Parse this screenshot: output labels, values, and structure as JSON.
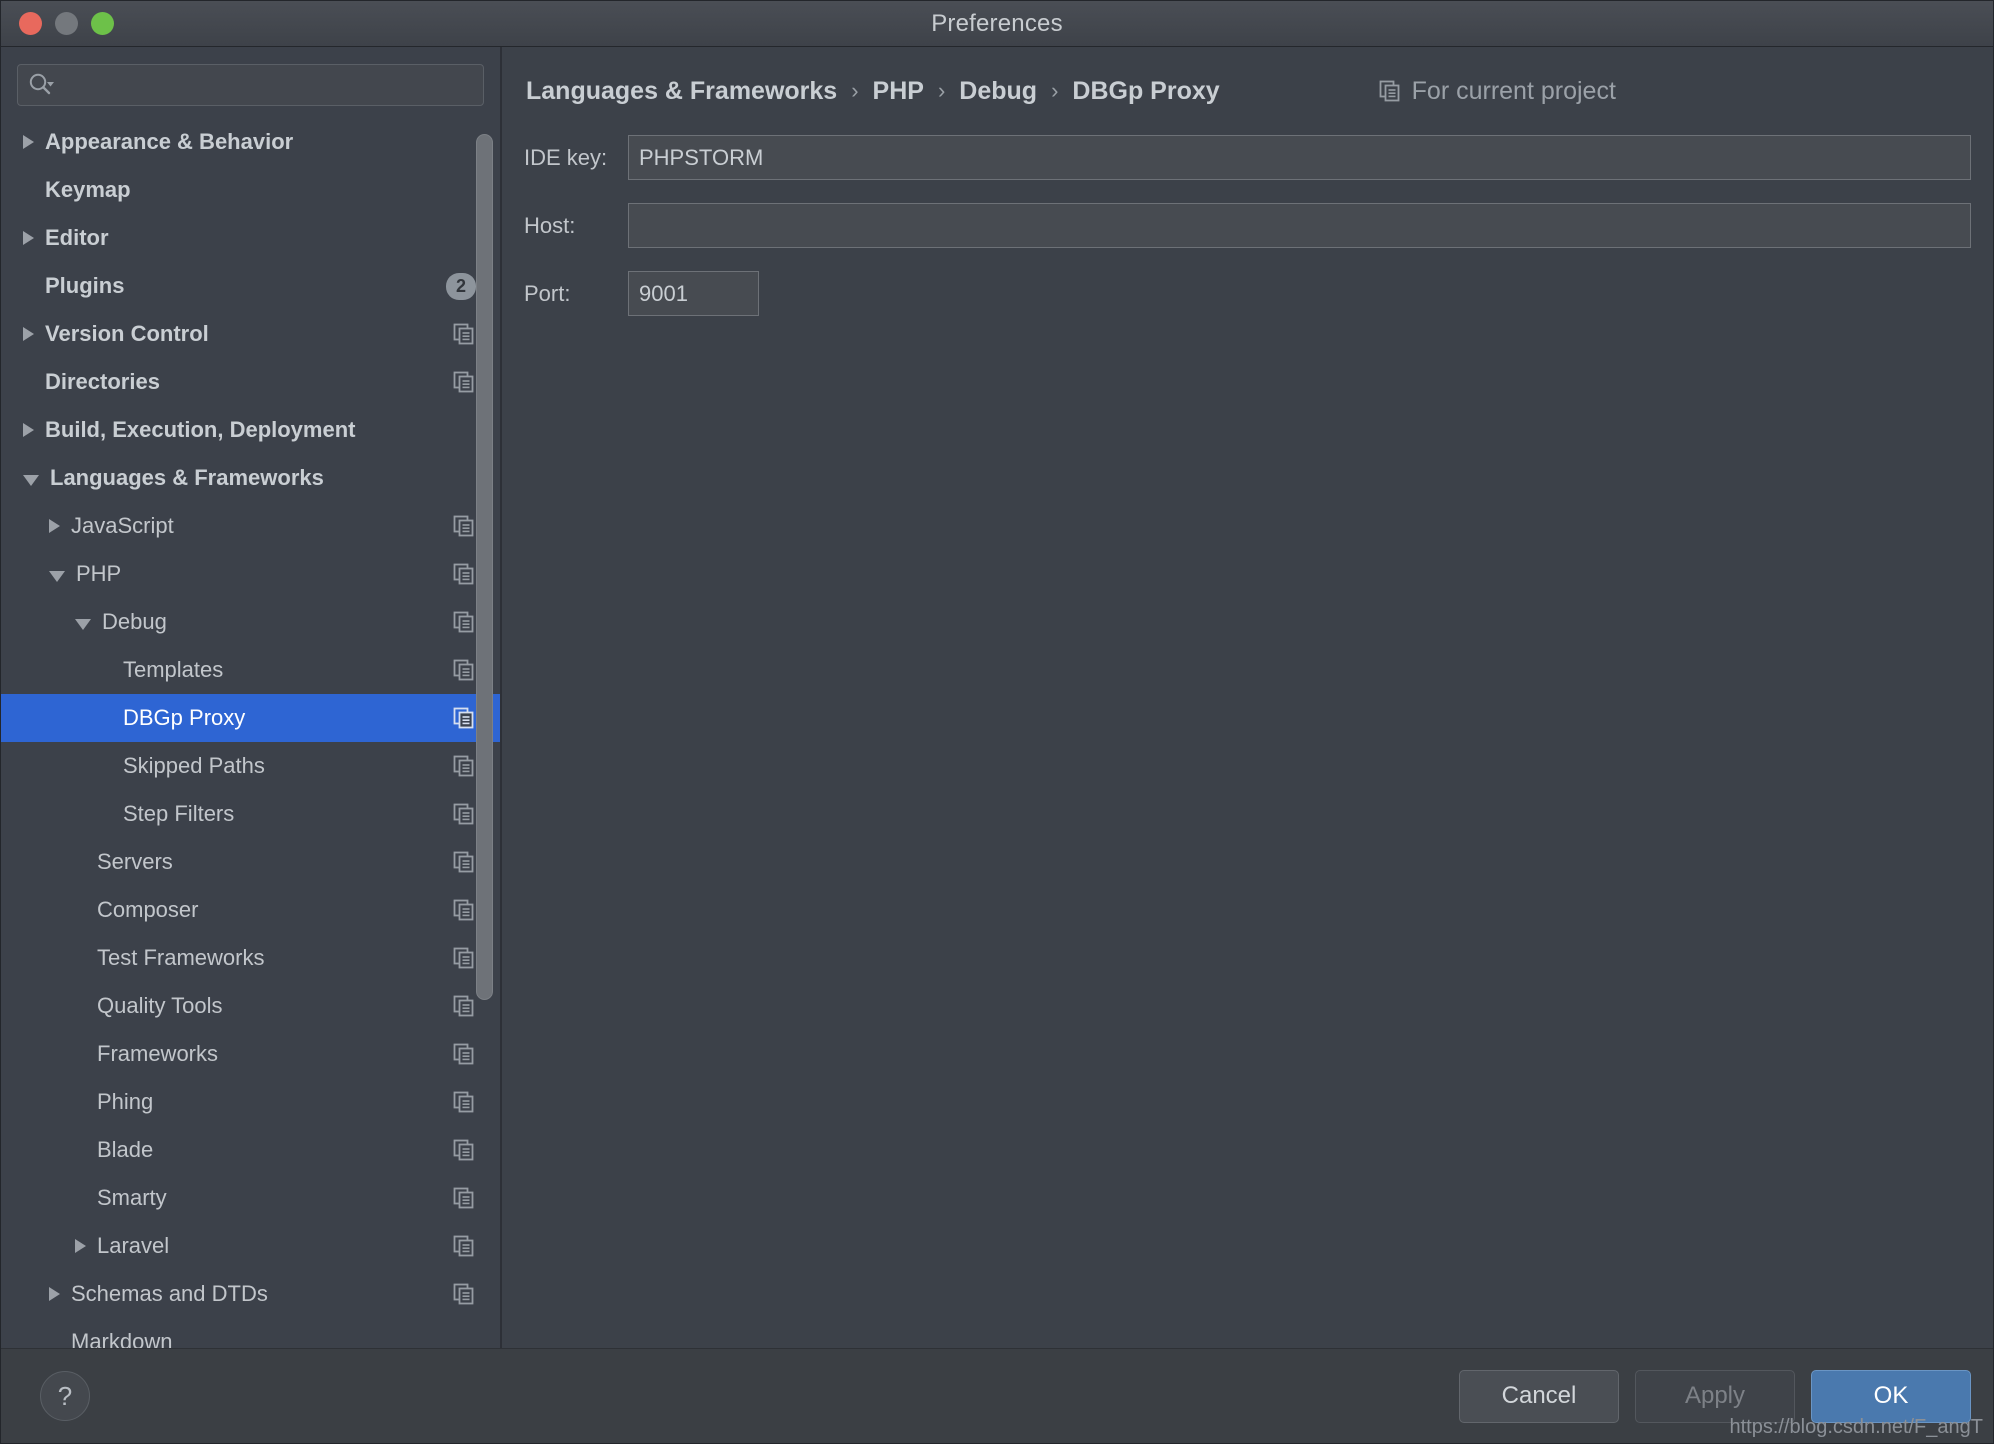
{
  "window": {
    "title": "Preferences",
    "traffic_lights": [
      "close-button",
      "minimize-button",
      "zoom-button"
    ]
  },
  "search": {
    "value": "",
    "placeholder": "",
    "icon": "search-icon"
  },
  "sidebar": {
    "items": [
      {
        "label": "Appearance & Behavior",
        "level": 0,
        "arrow": "collapsed",
        "badge": "",
        "copy": false,
        "selected": false
      },
      {
        "label": "Keymap",
        "level": 0,
        "arrow": "none",
        "badge": "",
        "copy": false,
        "selected": false
      },
      {
        "label": "Editor",
        "level": 0,
        "arrow": "collapsed",
        "badge": "",
        "copy": false,
        "selected": false
      },
      {
        "label": "Plugins",
        "level": 0,
        "arrow": "none",
        "badge": "2",
        "copy": false,
        "selected": false
      },
      {
        "label": "Version Control",
        "level": 0,
        "arrow": "collapsed",
        "badge": "",
        "copy": true,
        "selected": false
      },
      {
        "label": "Directories",
        "level": 0,
        "arrow": "none",
        "badge": "",
        "copy": true,
        "selected": false
      },
      {
        "label": "Build, Execution, Deployment",
        "level": 0,
        "arrow": "collapsed",
        "badge": "",
        "copy": false,
        "selected": false
      },
      {
        "label": "Languages & Frameworks",
        "level": 0,
        "arrow": "expanded",
        "badge": "",
        "copy": false,
        "selected": false
      },
      {
        "label": "JavaScript",
        "level": 1,
        "arrow": "collapsed",
        "badge": "",
        "copy": true,
        "selected": false
      },
      {
        "label": "PHP",
        "level": 1,
        "arrow": "expanded",
        "badge": "",
        "copy": true,
        "selected": false
      },
      {
        "label": "Debug",
        "level": 2,
        "arrow": "expanded",
        "badge": "",
        "copy": true,
        "selected": false
      },
      {
        "label": "Templates",
        "level": 3,
        "arrow": "none",
        "badge": "",
        "copy": true,
        "selected": false
      },
      {
        "label": "DBGp Proxy",
        "level": 3,
        "arrow": "none",
        "badge": "",
        "copy": true,
        "selected": true
      },
      {
        "label": "Skipped Paths",
        "level": 3,
        "arrow": "none",
        "badge": "",
        "copy": true,
        "selected": false
      },
      {
        "label": "Step Filters",
        "level": 3,
        "arrow": "none",
        "badge": "",
        "copy": true,
        "selected": false
      },
      {
        "label": "Servers",
        "level": 2,
        "arrow": "none",
        "badge": "",
        "copy": true,
        "selected": false
      },
      {
        "label": "Composer",
        "level": 2,
        "arrow": "none",
        "badge": "",
        "copy": true,
        "selected": false
      },
      {
        "label": "Test Frameworks",
        "level": 2,
        "arrow": "none",
        "badge": "",
        "copy": true,
        "selected": false
      },
      {
        "label": "Quality Tools",
        "level": 2,
        "arrow": "none",
        "badge": "",
        "copy": true,
        "selected": false
      },
      {
        "label": "Frameworks",
        "level": 2,
        "arrow": "none",
        "badge": "",
        "copy": true,
        "selected": false
      },
      {
        "label": "Phing",
        "level": 2,
        "arrow": "none",
        "badge": "",
        "copy": true,
        "selected": false
      },
      {
        "label": "Blade",
        "level": 2,
        "arrow": "none",
        "badge": "",
        "copy": true,
        "selected": false
      },
      {
        "label": "Smarty",
        "level": 2,
        "arrow": "none",
        "badge": "",
        "copy": true,
        "selected": false
      },
      {
        "label": "Laravel",
        "level": 2,
        "arrow": "collapsed",
        "badge": "",
        "copy": true,
        "selected": false
      },
      {
        "label": "Schemas and DTDs",
        "level": 1,
        "arrow": "collapsed",
        "badge": "",
        "copy": true,
        "selected": false
      },
      {
        "label": "Markdown",
        "level": 1,
        "arrow": "none",
        "badge": "",
        "copy": false,
        "selected": false
      }
    ]
  },
  "breadcrumb": {
    "crumbs": [
      "Languages & Frameworks",
      "PHP",
      "Debug",
      "DBGp Proxy"
    ],
    "separator": "›",
    "scope_label": "For current project",
    "scope_icon": "copy-icon"
  },
  "form": {
    "fields": [
      {
        "label": "IDE key:",
        "value": "PHPSTORM",
        "placeholder": "",
        "width": "wide",
        "name": "ide-key-field"
      },
      {
        "label": "Host:",
        "value": "",
        "placeholder": "",
        "width": "wide",
        "name": "host-field"
      },
      {
        "label": "Port:",
        "value": "9001",
        "placeholder": "",
        "width": "narrow",
        "name": "port-field"
      }
    ]
  },
  "footer": {
    "help_label": "?",
    "cancel_label": "Cancel",
    "apply_label": "Apply",
    "ok_label": "OK",
    "watermark": "https://blog.csdn.net/F_angT"
  },
  "colors": {
    "selection_blue": "#2e65d3",
    "primary_button": "#4a79ae",
    "window_bg": "#3c4149",
    "badge_gray": "#8d949c"
  }
}
